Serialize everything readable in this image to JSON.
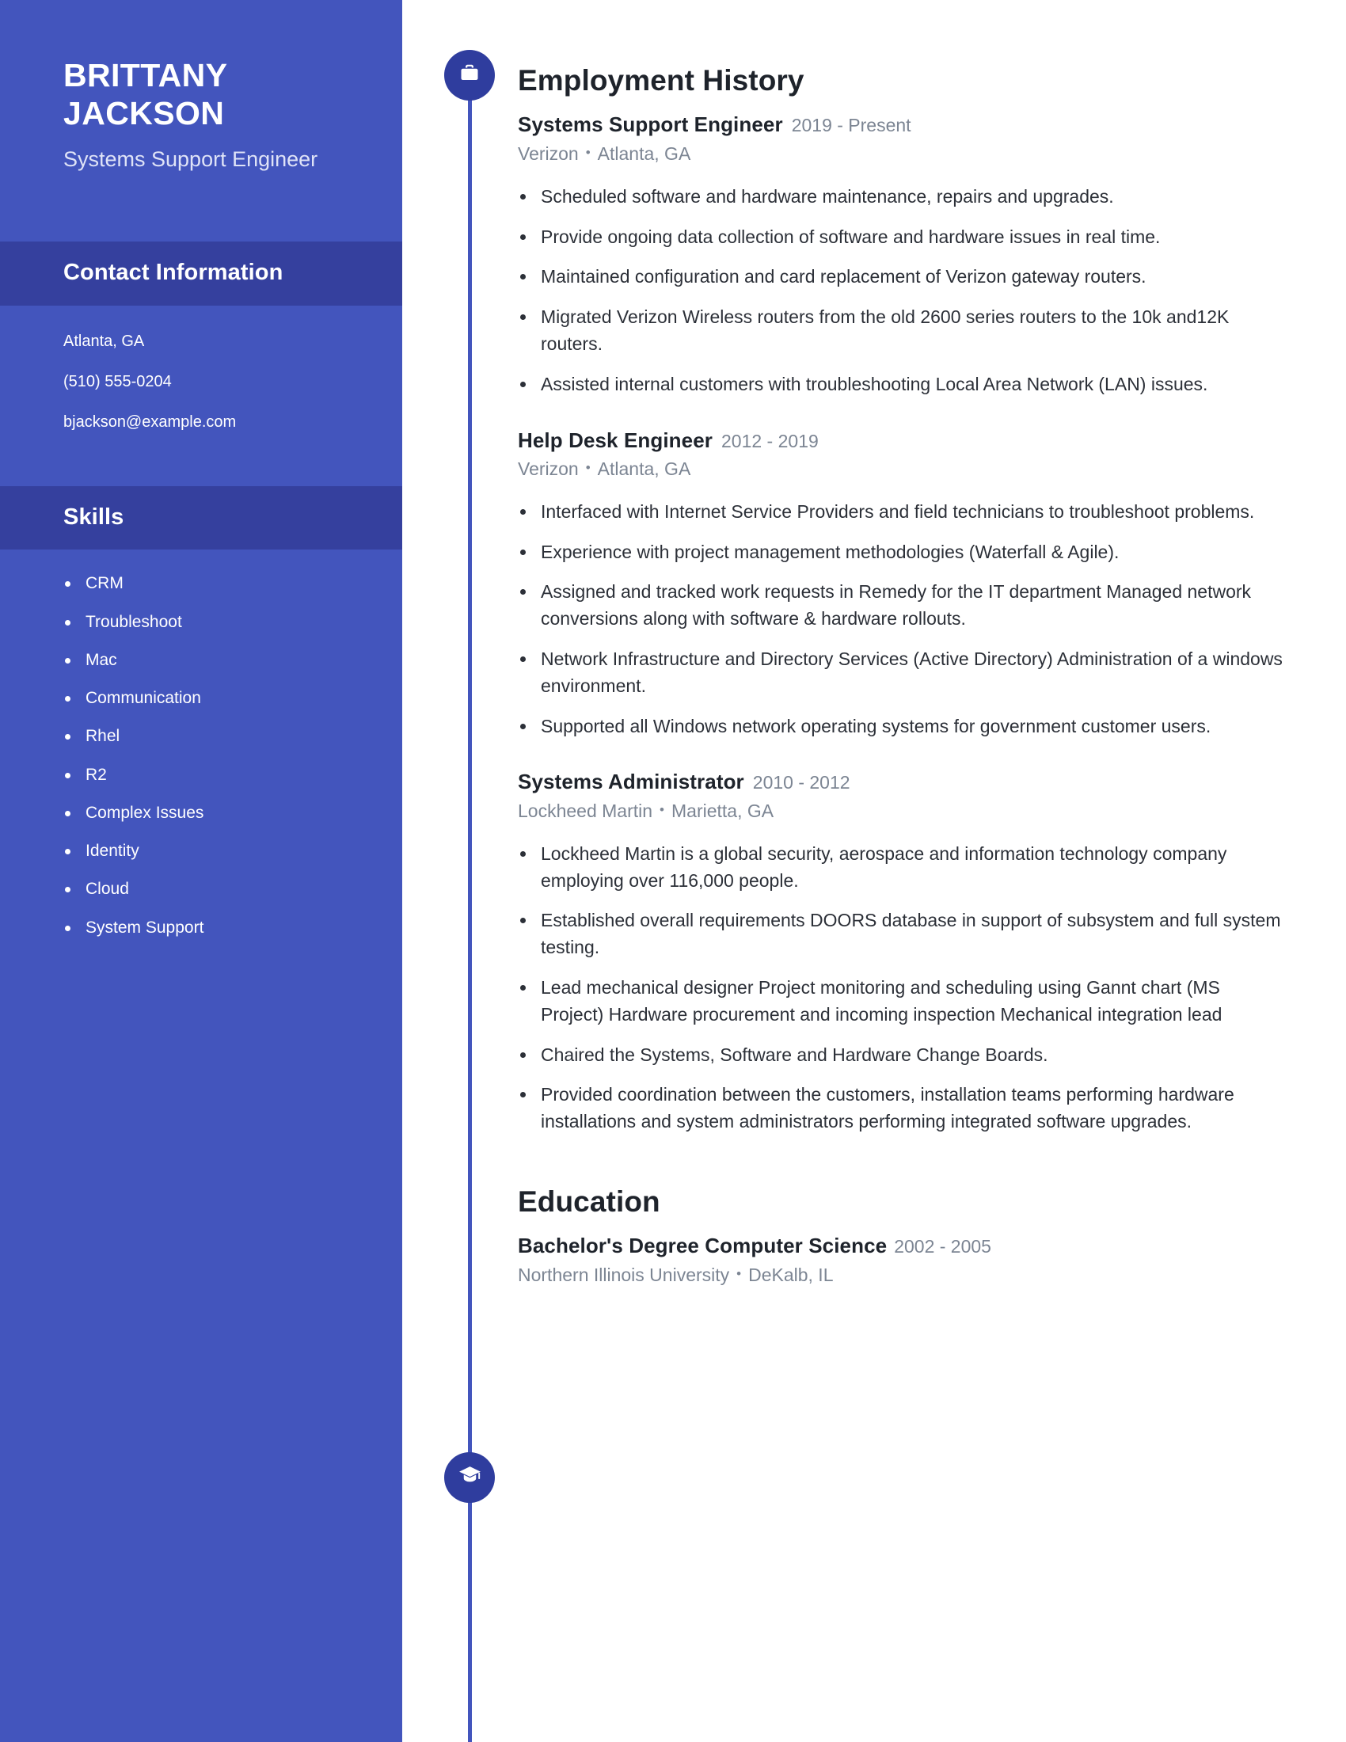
{
  "theme": {
    "sidebar_bg": "#4355bd",
    "sidebar_band_bg": "#35409e",
    "timeline_color": "#4355bd",
    "node_bg": "#2f3d9e",
    "heading_color": "#1e232b",
    "muted_color": "#7c8593",
    "body_color": "#2c3038"
  },
  "sidebar": {
    "name_line1": "BRITTANY",
    "name_line2": "JACKSON",
    "role": "Systems Support Engineer",
    "contact": {
      "heading": "Contact Information",
      "location": "Atlanta, GA",
      "phone": "(510) 555-0204",
      "email": "bjackson@example.com"
    },
    "skills": {
      "heading": "Skills",
      "items": [
        "CRM",
        "Troubleshoot",
        "Mac",
        "Communication",
        "Rhel",
        "R2",
        "Complex Issues",
        "Identity",
        "Cloud",
        "System Support"
      ]
    }
  },
  "employment": {
    "icon": "briefcase-icon",
    "heading": "Employment History",
    "jobs": [
      {
        "title": "Systems Support Engineer",
        "dates": "2019 - Present",
        "company": "Verizon",
        "location": "Atlanta, GA",
        "bullets": [
          "Scheduled software and hardware maintenance, repairs and upgrades.",
          "Provide ongoing data collection of software and hardware issues in real time.",
          "Maintained configuration and card replacement of Verizon gateway routers.",
          "Migrated Verizon Wireless routers from the old 2600 series routers to the 10k and12K routers.",
          "Assisted internal customers with troubleshooting Local Area Network (LAN) issues."
        ]
      },
      {
        "title": "Help Desk Engineer",
        "dates": "2012 - 2019",
        "company": "Verizon",
        "location": "Atlanta, GA",
        "bullets": [
          "Interfaced with Internet Service Providers and field technicians to troubleshoot problems.",
          "Experience with project management methodologies (Waterfall & Agile).",
          "Assigned and tracked work requests in Remedy for the IT department Managed network conversions along with software & hardware rollouts.",
          "Network Infrastructure and Directory Services (Active Directory) Administration of a windows environment.",
          "Supported all Windows network operating systems for government customer users."
        ]
      },
      {
        "title": "Systems Administrator",
        "dates": "2010 - 2012",
        "company": "Lockheed Martin",
        "location": "Marietta, GA",
        "bullets": [
          "Lockheed Martin is a global security, aerospace and information technology company employing over 116,000 people.",
          "Established overall requirements DOORS database in support of subsystem and full system testing.",
          "Lead mechanical designer Project monitoring and scheduling using Gannt chart (MS Project) Hardware procurement and incoming inspection Mechanical integration lead",
          "Chaired the Systems, Software and Hardware Change Boards.",
          "Provided coordination between the customers, installation teams performing hardware installations and system administrators performing integrated software upgrades."
        ]
      }
    ]
  },
  "education": {
    "icon": "graduation-cap-icon",
    "heading": "Education",
    "entries": [
      {
        "degree": "Bachelor's Degree Computer Science",
        "dates": "2002 - 2005",
        "school": "Northern Illinois University",
        "location": "DeKalb, IL"
      }
    ]
  },
  "separator": "•"
}
